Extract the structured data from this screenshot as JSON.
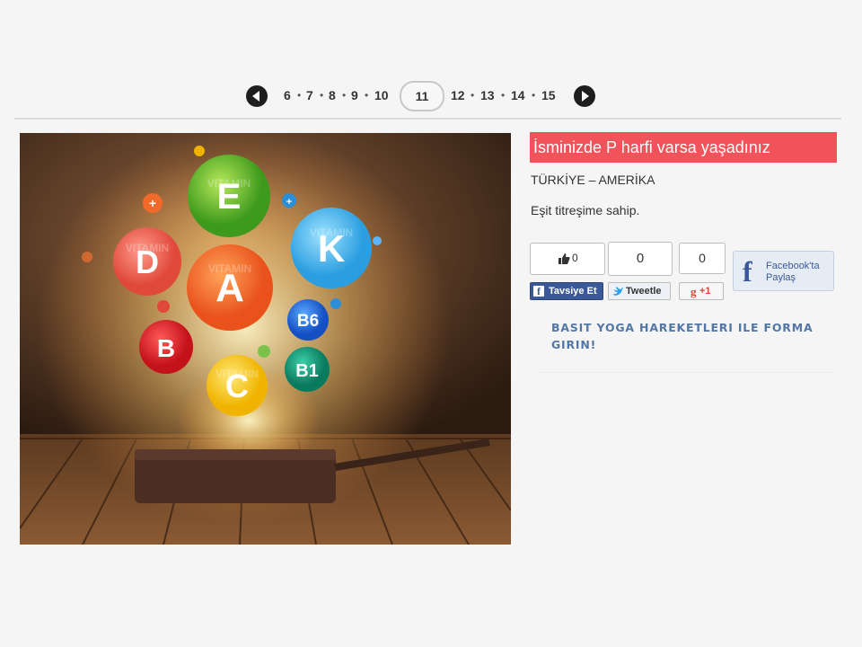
{
  "pagination": {
    "pages_before": [
      "6",
      "7",
      "8",
      "9",
      "10"
    ],
    "current": "11",
    "pages_after": [
      "12",
      "13",
      "14",
      "15"
    ],
    "separator": "•"
  },
  "article": {
    "title": "İsminizde P harfi varsa yaşadınız",
    "subtitle": "TÜRKİYE – AMERİKA",
    "description": "Eşit titreşime sahip."
  },
  "hero_image": {
    "vitamins": [
      "E",
      "D",
      "A",
      "K",
      "B",
      "B6",
      "B1",
      "C"
    ],
    "bubble_text": "VITAMIN"
  },
  "social": {
    "facebook_count": "0",
    "facebook_label": "Tavsiye Et",
    "twitter_count": "0",
    "twitter_label": "Tweetle",
    "gplus_count": "0",
    "gplus_label": "+1",
    "share_line1": "Facebook'ta",
    "share_line2": "Paylaş"
  },
  "related_link": "BASIT YOGA HAREKETLERI ILE FORMA GIRIN!",
  "colors": {
    "title_bg": "#f0535a",
    "link": "#5476a4",
    "facebook": "#3b5998",
    "twitter": "#2aa3ef",
    "gplus": "#d34836"
  }
}
